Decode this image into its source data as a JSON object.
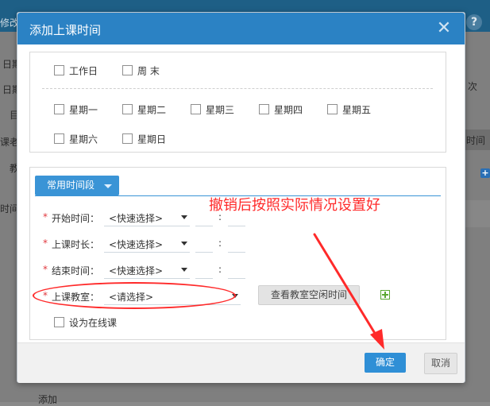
{
  "background": {
    "fragments": [
      "修改",
      "日期",
      "日期",
      "目",
      "课老师",
      "教",
      "时间",
      "次",
      "时间",
      "添加"
    ],
    "help_glyph": "?",
    "plus_glyph": "+"
  },
  "dialog": {
    "title": "添加上课时间",
    "close_glyph": "✕",
    "days": {
      "quick": [
        {
          "label": "工作日",
          "checked": false
        },
        {
          "label": "周 末",
          "checked": false
        }
      ],
      "weekdays": [
        {
          "label": "星期一",
          "checked": false
        },
        {
          "label": "星期二",
          "checked": false
        },
        {
          "label": "星期三",
          "checked": false
        },
        {
          "label": "星期四",
          "checked": false
        },
        {
          "label": "星期五",
          "checked": false
        },
        {
          "label": "星期六",
          "checked": false
        },
        {
          "label": "星期日",
          "checked": false
        }
      ]
    },
    "time_panel": {
      "tab_label": "常用时间段",
      "required_mark": "*",
      "start_time": {
        "label": "开始时间：",
        "select": "<快速选择>",
        "sep": ":"
      },
      "duration": {
        "label": "上课时长：",
        "select": "<快速选择>",
        "sep": ":"
      },
      "end_time": {
        "label": "结束时间：",
        "select": "<快速选择>",
        "sep": ":"
      },
      "classroom": {
        "label": "上课教室：",
        "select": "<请选择>"
      },
      "view_button": "查看教室空闲时间",
      "online": {
        "label": "设为在线课",
        "checked": false
      }
    },
    "annotation": "撤销后按照实际情况设置好",
    "footer": {
      "ok": "确定",
      "cancel": "取消"
    }
  },
  "colors": {
    "header": "#2b82c4",
    "primary_button": "#2f8fd6",
    "annotation_red": "#ff2a2a",
    "required_red": "#e0383e",
    "add_green": "#5aa832"
  }
}
